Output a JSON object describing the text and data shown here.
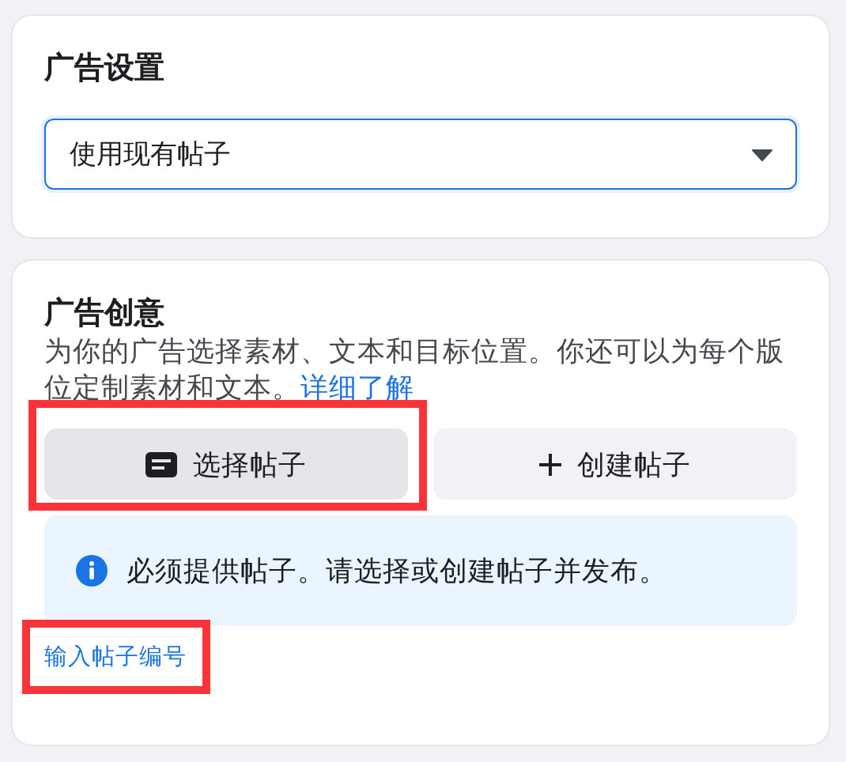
{
  "ad_settings": {
    "title": "广告设置",
    "dropdown": {
      "value": "使用现有帖子",
      "focused": true
    }
  },
  "ad_creative": {
    "title": "广告创意",
    "description": "为你的广告选择素材、文本和目标位置。你还可以为每个版位定制素材和文本。",
    "learn_more_link": "详细了解",
    "options": [
      {
        "kind": "select",
        "label": "选择帖子",
        "selected": true,
        "highlighted": true
      },
      {
        "kind": "create",
        "label": "创建帖子",
        "selected": false,
        "highlighted": false
      }
    ],
    "notice": "必须提供帖子。请选择或创建帖子并发布。",
    "post_id_link": {
      "label": "输入帖子编号",
      "highlighted": true
    }
  }
}
